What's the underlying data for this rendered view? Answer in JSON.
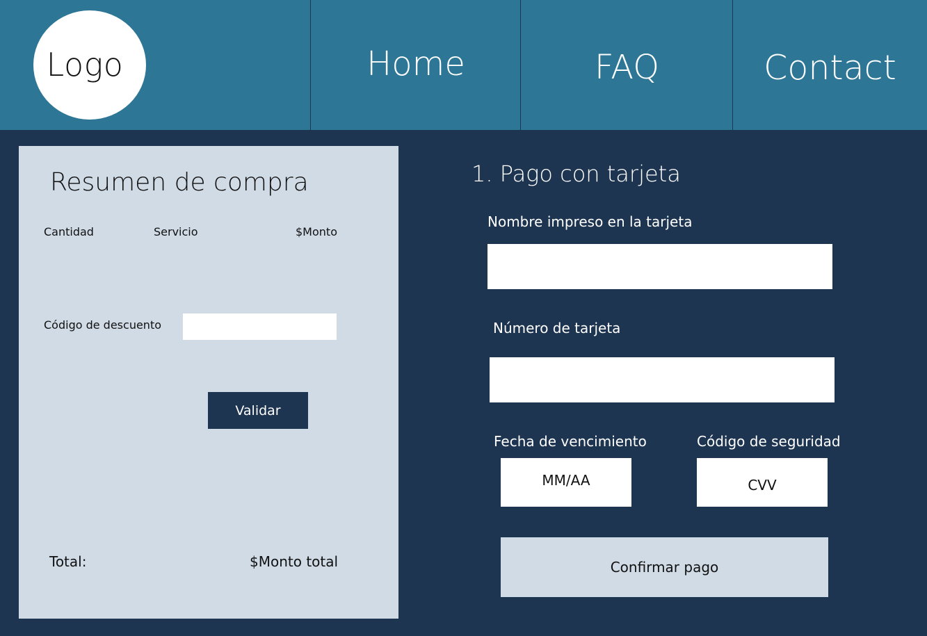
{
  "header": {
    "logo_text": "Logo",
    "nav": {
      "home": "Home",
      "faq": "FAQ",
      "contact": "Contact"
    }
  },
  "summary": {
    "title": "Resumen de compra",
    "columns": {
      "quantity": "Cantidad",
      "service": "Servicio",
      "amount": "$Monto"
    },
    "discount_label": "Código de descuento",
    "discount_value": "",
    "validate_label": "Validar",
    "total_label": "Total:",
    "total_amount": "$Monto total"
  },
  "payment": {
    "title": "1. Pago con tarjeta",
    "name_label": "Nombre impreso en la tarjeta",
    "name_value": "",
    "number_label": "Número de tarjeta",
    "number_value": "",
    "expiry_label": "Fecha de vencimiento",
    "expiry_placeholder": "MM/AA",
    "cvv_label": "Código de seguridad",
    "cvv_placeholder": "CVV",
    "confirm_label": "Confirmar pago"
  },
  "colors": {
    "header_bg": "#2d7696",
    "page_bg": "#1e3551",
    "panel_bg": "#d0dbe6",
    "input_bg": "#ffffff"
  }
}
